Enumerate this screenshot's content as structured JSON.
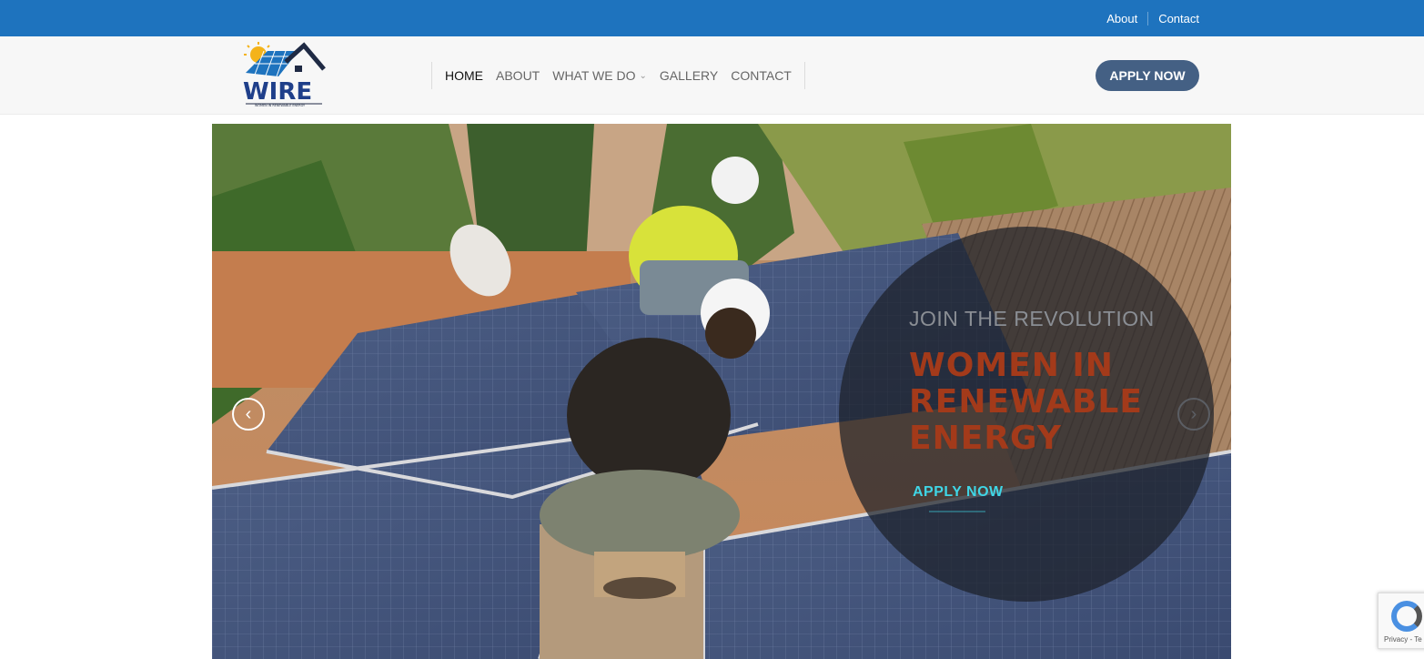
{
  "topbar": {
    "links": [
      "About",
      "Contact"
    ],
    "color": "#1e73be"
  },
  "logo": {
    "text": "WIRE",
    "tagline": "WOMEN IN RENEWABLE ENERGY"
  },
  "nav": {
    "items": [
      {
        "label": "HOME",
        "active": true
      },
      {
        "label": "ABOUT"
      },
      {
        "label": "WHAT WE DO",
        "dropdown": true
      },
      {
        "label": "GALLERY"
      },
      {
        "label": "CONTACT"
      }
    ]
  },
  "header": {
    "apply_label": "APPLY NOW",
    "apply_color": "#446084"
  },
  "hero": {
    "kicker": "JOIN THE REVOLUTION",
    "headline": "WOMEN IN RENEWABLE ENERGY",
    "cta": "APPLY NOW",
    "prev_icon": "chevron-left-icon",
    "next_icon": "chevron-right-icon",
    "headline_color": "#a33a1a",
    "cta_color": "#3fd6e6"
  },
  "recaptcha": {
    "text": "Privacy - Te"
  }
}
